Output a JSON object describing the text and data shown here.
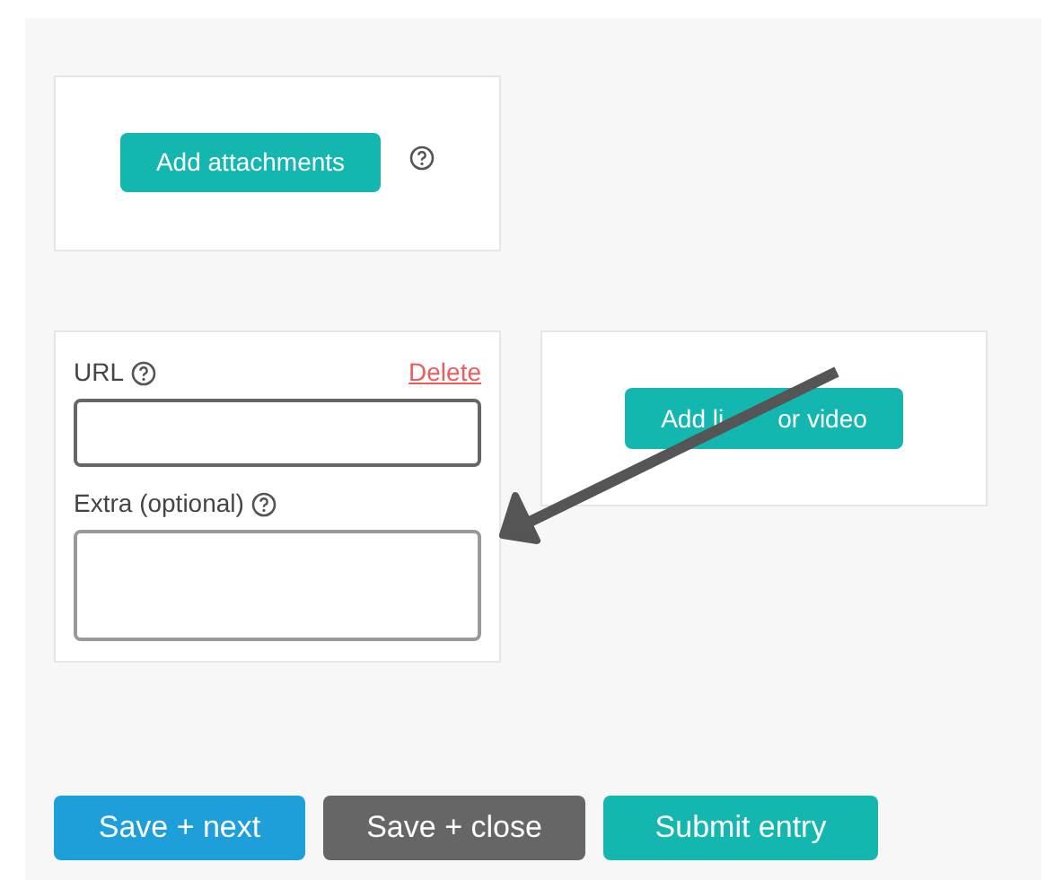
{
  "attachments": {
    "button": "Add attachments"
  },
  "link": {
    "url_label": "URL",
    "delete": "Delete",
    "extra_label": "Extra (optional)"
  },
  "link_button": {
    "shown_start": "Add li",
    "shown_end": "or video"
  },
  "actions": [
    {
      "label": "Save + next",
      "kind": "next"
    },
    {
      "label": "Save + close",
      "kind": "close"
    },
    {
      "label": "Submit entry",
      "kind": "submit"
    }
  ]
}
